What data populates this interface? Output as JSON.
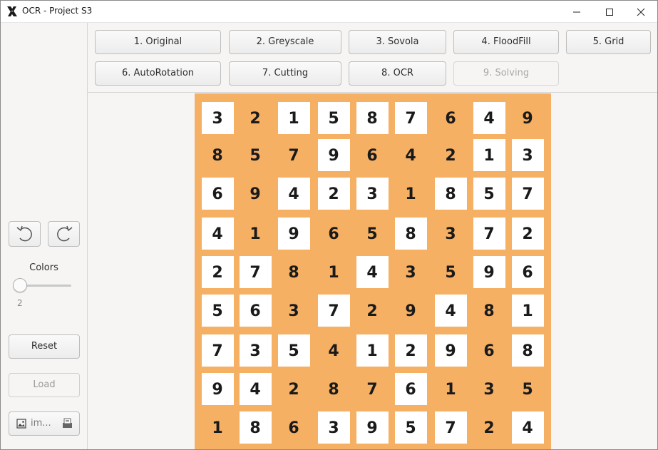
{
  "window": {
    "title": "OCR - Project S3",
    "icons": {
      "app": "x-logo-icon",
      "minimize": "minimize-icon",
      "maximize": "maximize-icon",
      "close": "close-icon"
    }
  },
  "toolbar": {
    "steps": [
      {
        "label": "1. Original",
        "enabled": true
      },
      {
        "label": "2. Greyscale",
        "enabled": true
      },
      {
        "label": "3. Sovola",
        "enabled": true
      },
      {
        "label": "4. FloodFill",
        "enabled": true
      },
      {
        "label": "5. Grid",
        "enabled": true
      },
      {
        "label": "6. AutoRotation",
        "enabled": true
      },
      {
        "label": "7. Cutting",
        "enabled": true
      },
      {
        "label": "8. OCR",
        "enabled": true
      },
      {
        "label": "9. Solving",
        "enabled": false
      }
    ]
  },
  "sidebar": {
    "rotate_left_icon": "rotate-left-icon",
    "rotate_right_icon": "rotate-right-icon",
    "colors_label": "Colors",
    "colors_value": 2,
    "colors_value_text": "2",
    "reset_label": "Reset",
    "load_label": "Load",
    "file_label": "im...",
    "file_icon": "image-icon",
    "open_icon": "open-file-icon"
  },
  "board": {
    "background": "#f5b064",
    "rows": [
      [
        3,
        2,
        1,
        5,
        8,
        7,
        6,
        4,
        9
      ],
      [
        8,
        5,
        7,
        9,
        6,
        4,
        2,
        1,
        3
      ],
      [
        6,
        9,
        4,
        2,
        3,
        1,
        8,
        5,
        7
      ],
      [
        4,
        1,
        9,
        6,
        5,
        8,
        3,
        7,
        2
      ],
      [
        2,
        7,
        8,
        1,
        4,
        3,
        5,
        9,
        6
      ],
      [
        5,
        6,
        3,
        7,
        2,
        9,
        4,
        8,
        1
      ],
      [
        7,
        3,
        5,
        4,
        1,
        2,
        9,
        6,
        8
      ],
      [
        9,
        4,
        2,
        8,
        7,
        6,
        1,
        3,
        5
      ],
      [
        1,
        8,
        6,
        3,
        9,
        5,
        7,
        2,
        4
      ]
    ],
    "boxed": [
      [
        1,
        0,
        1,
        1,
        1,
        1,
        0,
        1,
        0
      ],
      [
        0,
        0,
        0,
        1,
        0,
        0,
        0,
        1,
        1
      ],
      [
        1,
        0,
        1,
        1,
        1,
        0,
        1,
        1,
        1
      ],
      [
        1,
        0,
        1,
        0,
        0,
        1,
        0,
        1,
        1
      ],
      [
        1,
        1,
        0,
        0,
        1,
        0,
        0,
        1,
        1
      ],
      [
        1,
        1,
        0,
        1,
        0,
        0,
        1,
        0,
        1
      ],
      [
        1,
        1,
        1,
        0,
        1,
        1,
        1,
        0,
        1
      ],
      [
        1,
        1,
        0,
        0,
        0,
        1,
        0,
        0,
        0
      ],
      [
        0,
        1,
        0,
        1,
        1,
        1,
        1,
        0,
        1
      ]
    ]
  }
}
